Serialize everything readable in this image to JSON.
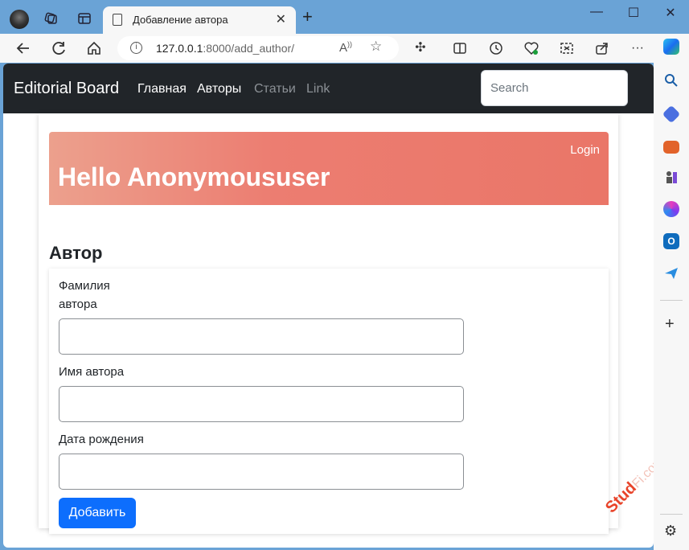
{
  "browser": {
    "tab_title": "Добавление автора",
    "url_host": "127.0.0.1",
    "url_rest": ":8000/add_author/",
    "new_tab_glyph": "+",
    "close_tab_glyph": "✕",
    "window_controls": [
      "—",
      "☐",
      "✕"
    ]
  },
  "site": {
    "brand": "Editorial Board",
    "nav": [
      {
        "label": "Главная",
        "active": true
      },
      {
        "label": "Авторы",
        "active": true
      },
      {
        "label": "Статьи",
        "active": false
      },
      {
        "label": "Link",
        "active": false
      }
    ],
    "search_placeholder": "Search"
  },
  "hero": {
    "login_label": "Login",
    "greeting": "Hello Anonymoususer"
  },
  "form": {
    "section_title": "Автор",
    "fields": [
      {
        "label": "Фамилия\nавтора",
        "value": ""
      },
      {
        "label": "Имя автора",
        "value": ""
      },
      {
        "label": "Дата рождения",
        "value": ""
      }
    ],
    "submit_label": "Добавить"
  },
  "watermark": {
    "brand": "Stud",
    "rest": "Fi.com"
  },
  "colors": {
    "navbar_bg": "#212529",
    "hero_start": "#eca08d",
    "hero_end": "#ea7668",
    "primary": "#0d6efd",
    "browser_frame": "#6aa3d6"
  }
}
